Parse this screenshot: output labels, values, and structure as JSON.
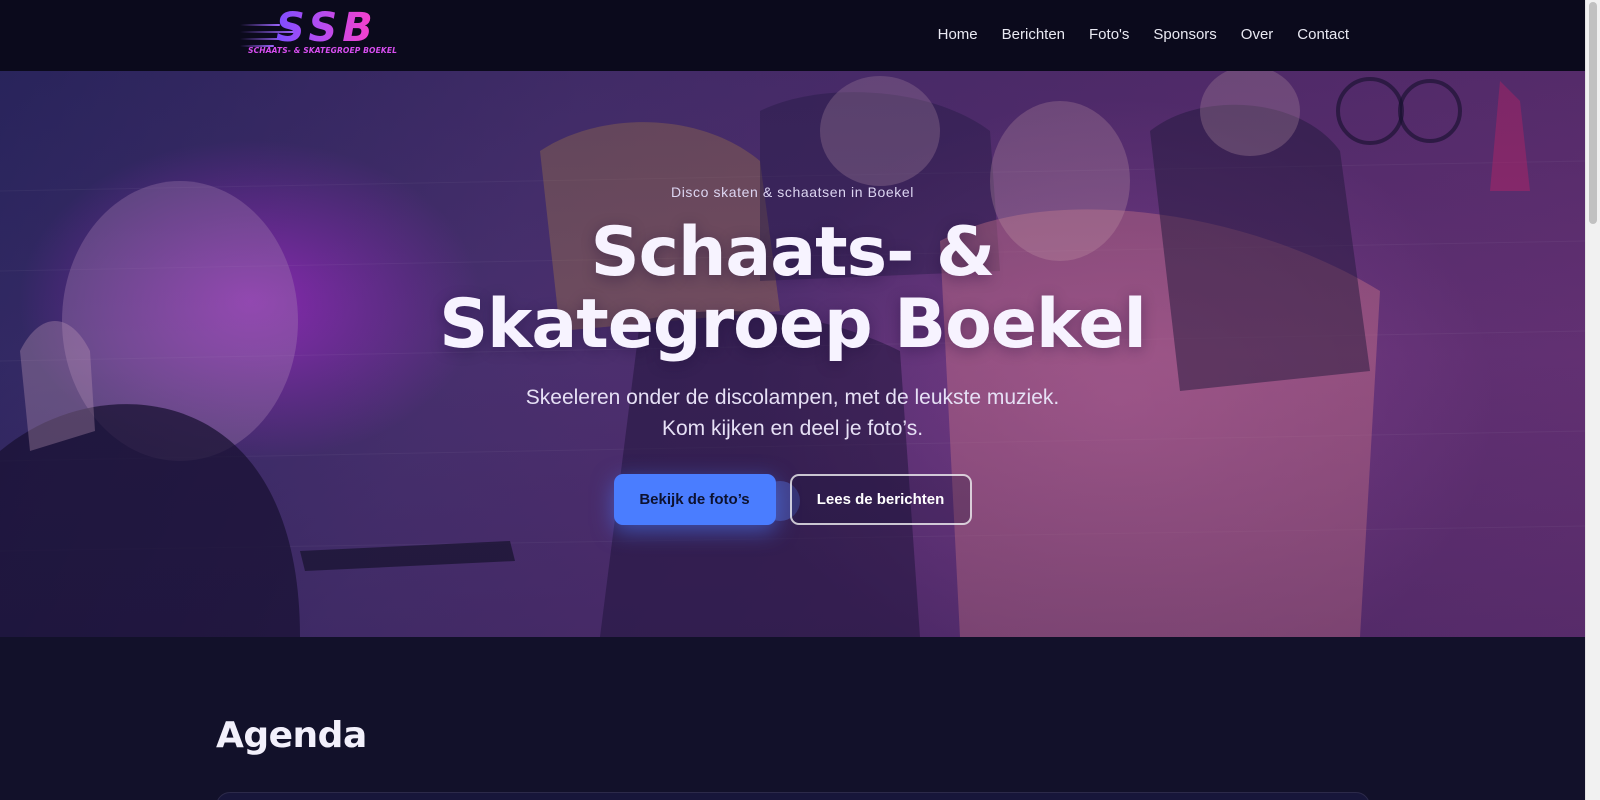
{
  "header": {
    "logo": {
      "letters": "SSB",
      "tagline": "SCHAATS- & SKATEGROEP BOEKEL"
    },
    "nav": [
      {
        "label": "Home"
      },
      {
        "label": "Berichten"
      },
      {
        "label": "Foto's"
      },
      {
        "label": "Sponsors"
      },
      {
        "label": "Over"
      },
      {
        "label": "Contact"
      }
    ]
  },
  "hero": {
    "eyebrow": "Disco skaten & schaatsen in Boekel",
    "title_line1": "Schaats- &",
    "title_line2": "Skategroep Boekel",
    "subtitle_line1": "Skeeleren onder de discolampen, met de leukste muziek.",
    "subtitle_line2": "Kom kijken en deel je foto’s.",
    "primary_button": "Bekijk de foto’s",
    "secondary_button": "Lees de berichten",
    "photo": "group-of-children-skating-photo"
  },
  "agenda": {
    "title": "Agenda"
  },
  "colors": {
    "header_bg": "#0b0a1c",
    "page_bg": "#12112a",
    "accent": "#4a7dff",
    "logo_gradient_start": "#7d4dff",
    "logo_gradient_end": "#ff3ec8"
  }
}
